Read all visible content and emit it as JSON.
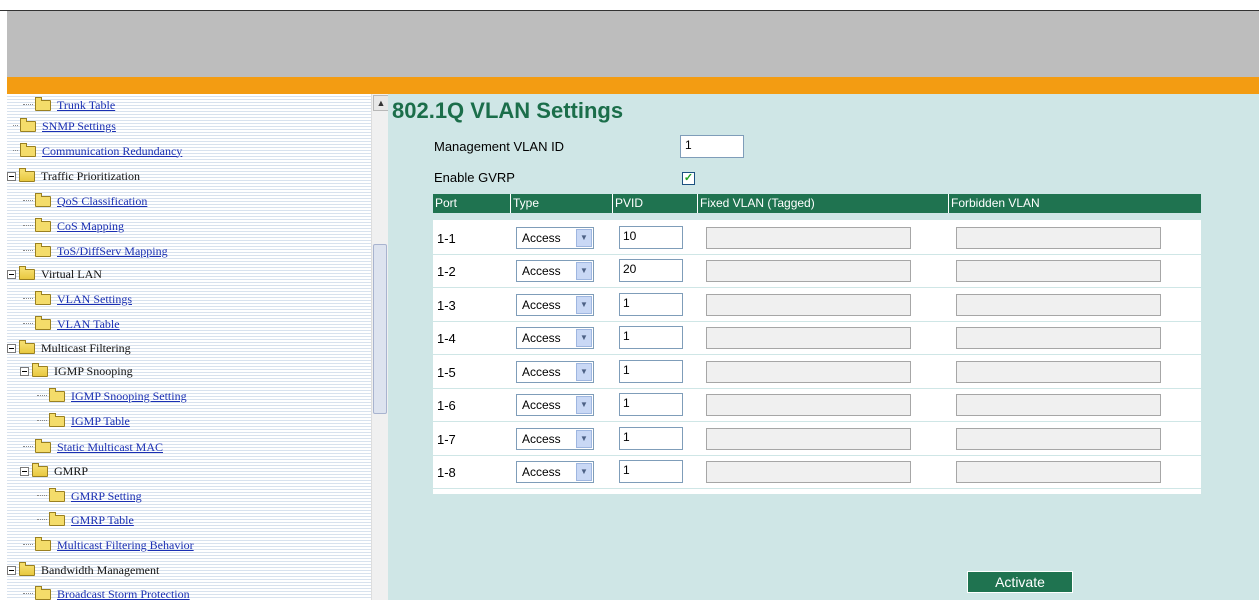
{
  "sidebar": {
    "items": [
      {
        "label": "Trunk Table",
        "link": true
      },
      {
        "label": "SNMP Settings",
        "link": true
      },
      {
        "label": "Communication Redundancy",
        "link": true
      },
      {
        "label": "Traffic Prioritization",
        "link": false
      },
      {
        "label": "QoS Classification",
        "link": true
      },
      {
        "label": "CoS Mapping",
        "link": true
      },
      {
        "label": "ToS/DiffServ Mapping",
        "link": true
      },
      {
        "label": "Virtual LAN",
        "link": false
      },
      {
        "label": "VLAN Settings",
        "link": true
      },
      {
        "label": "VLAN Table",
        "link": true
      },
      {
        "label": "Multicast Filtering",
        "link": false
      },
      {
        "label": "IGMP Snooping",
        "link": false
      },
      {
        "label": "IGMP Snooping Setting",
        "link": true
      },
      {
        "label": "IGMP Table",
        "link": true
      },
      {
        "label": "Static Multicast MAC",
        "link": true
      },
      {
        "label": "GMRP",
        "link": false
      },
      {
        "label": "GMRP Setting",
        "link": true
      },
      {
        "label": "GMRP Table",
        "link": true
      },
      {
        "label": "Multicast Filtering Behavior",
        "link": true
      },
      {
        "label": "Bandwidth Management",
        "link": false
      },
      {
        "label": "Broadcast Storm Protection",
        "link": true
      }
    ]
  },
  "main": {
    "title": "802.1Q VLAN Settings",
    "management_vlan_label": "Management VLAN ID",
    "management_vlan_value": "1",
    "enable_gvrp_label": "Enable GVRP",
    "enable_gvrp_checked": true,
    "table": {
      "headers": [
        "Port",
        "Type",
        "PVID",
        "Fixed VLAN (Tagged)",
        "Forbidden VLAN"
      ],
      "rows": [
        {
          "port": "1-1",
          "type": "Access",
          "pvid": "10",
          "fixed": "",
          "forbidden": ""
        },
        {
          "port": "1-2",
          "type": "Access",
          "pvid": "20",
          "fixed": "",
          "forbidden": ""
        },
        {
          "port": "1-3",
          "type": "Access",
          "pvid": "1",
          "fixed": "",
          "forbidden": ""
        },
        {
          "port": "1-4",
          "type": "Access",
          "pvid": "1",
          "fixed": "",
          "forbidden": ""
        },
        {
          "port": "1-5",
          "type": "Access",
          "pvid": "1",
          "fixed": "",
          "forbidden": ""
        },
        {
          "port": "1-6",
          "type": "Access",
          "pvid": "1",
          "fixed": "",
          "forbidden": ""
        },
        {
          "port": "1-7",
          "type": "Access",
          "pvid": "1",
          "fixed": "",
          "forbidden": ""
        },
        {
          "port": "1-8",
          "type": "Access",
          "pvid": "1",
          "fixed": "",
          "forbidden": ""
        }
      ]
    },
    "activate_label": "Activate"
  },
  "colors": {
    "header_band": "#bdbdbd",
    "accent_orange": "#f39c12",
    "table_header": "#1f7350",
    "content_bg": "#cfe6e6",
    "title_green": "#1b6e4a"
  }
}
